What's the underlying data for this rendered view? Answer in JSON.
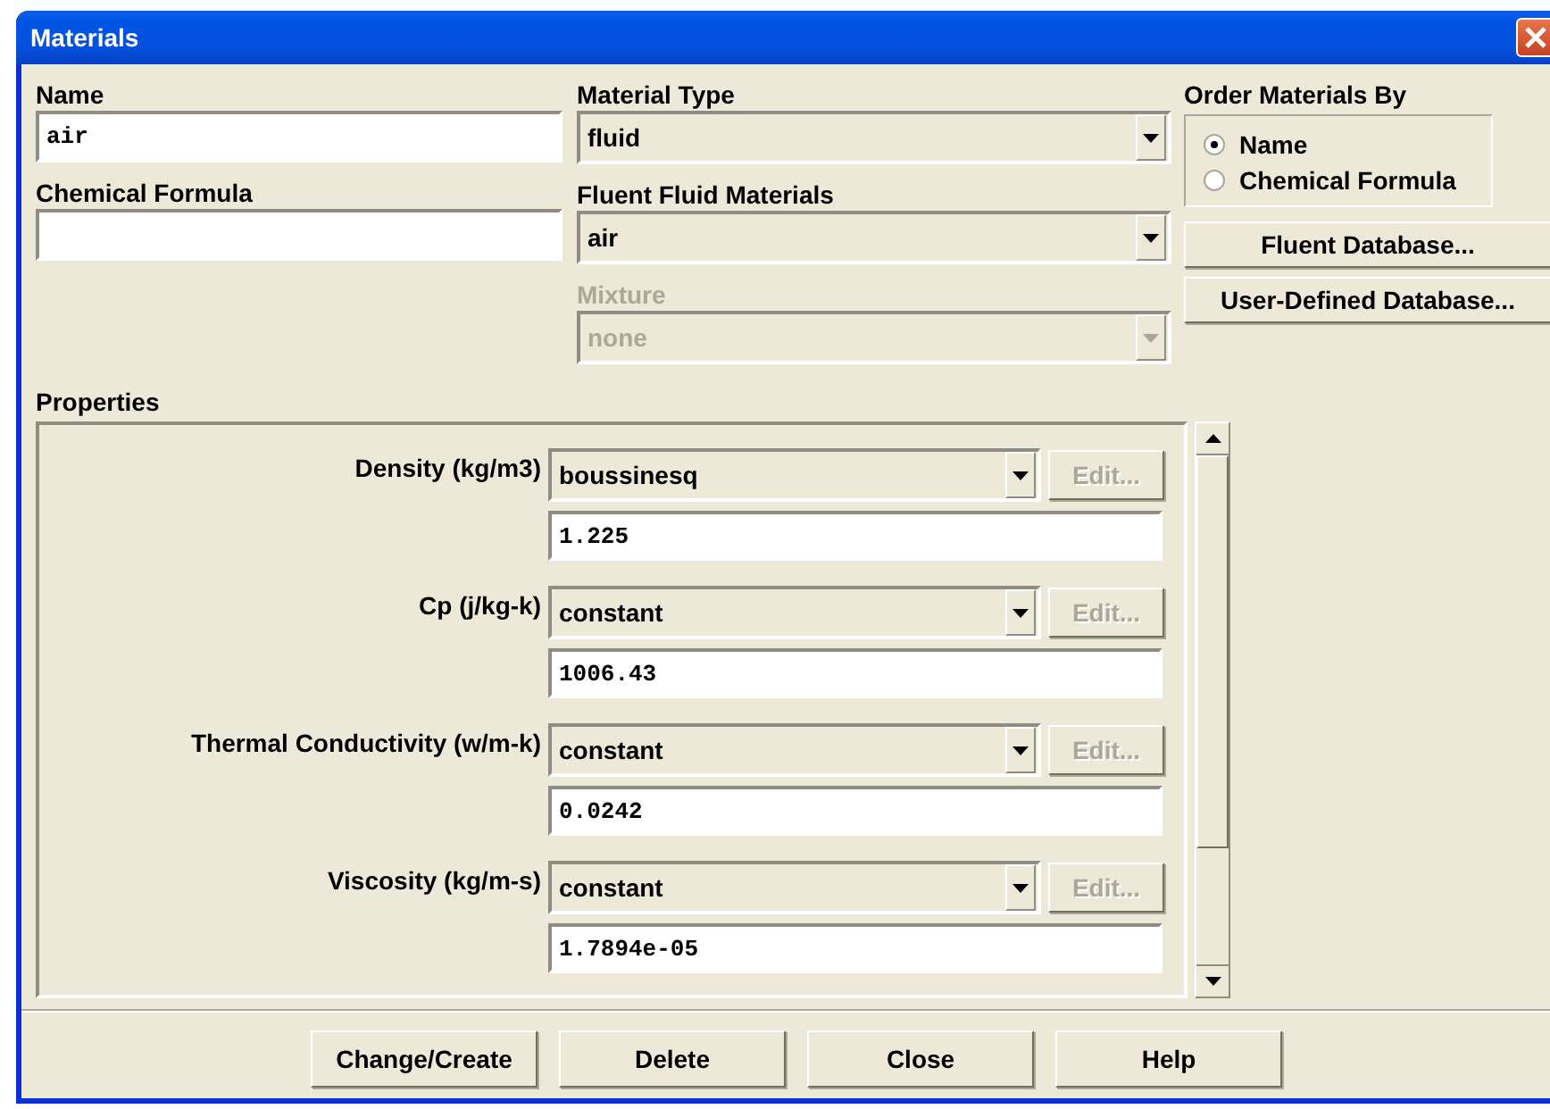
{
  "window": {
    "title": "Materials"
  },
  "name": {
    "label": "Name",
    "value": "air"
  },
  "chemical_formula": {
    "label": "Chemical Formula"
  },
  "combos": [
    {
      "label": "Material Type",
      "value": "fluid",
      "disabled": false
    },
    {
      "label": "Fluent Fluid Materials",
      "value": "air",
      "disabled": false
    },
    {
      "label": "Mixture",
      "value": "none",
      "disabled": true
    }
  ],
  "order_by": {
    "label": "Order Materials By",
    "options": [
      {
        "label": "Name",
        "selected": true
      },
      {
        "label": "Chemical Formula",
        "selected": false
      }
    ]
  },
  "database_buttons": [
    "Fluent Database...",
    "User-Defined Database..."
  ],
  "properties": {
    "label": "Properties",
    "rows": [
      {
        "name": "Density (kg/m3)",
        "method": "boussinesq",
        "value": "1.225",
        "edit": "Edit...",
        "edit_disabled": true
      },
      {
        "name": "Cp (j/kg-k)",
        "method": "constant",
        "value": "1006.43",
        "edit": "Edit...",
        "edit_disabled": true
      },
      {
        "name": "Thermal Conductivity (w/m-k)",
        "method": "constant",
        "value": "0.0242",
        "edit": "Edit...",
        "edit_disabled": true
      },
      {
        "name": "Viscosity (kg/m-s)",
        "method": "constant",
        "value": "1.7894e-05",
        "edit": "Edit...",
        "edit_disabled": true
      }
    ]
  },
  "buttons": [
    "Change/Create",
    "Delete",
    "Close",
    "Help"
  ]
}
